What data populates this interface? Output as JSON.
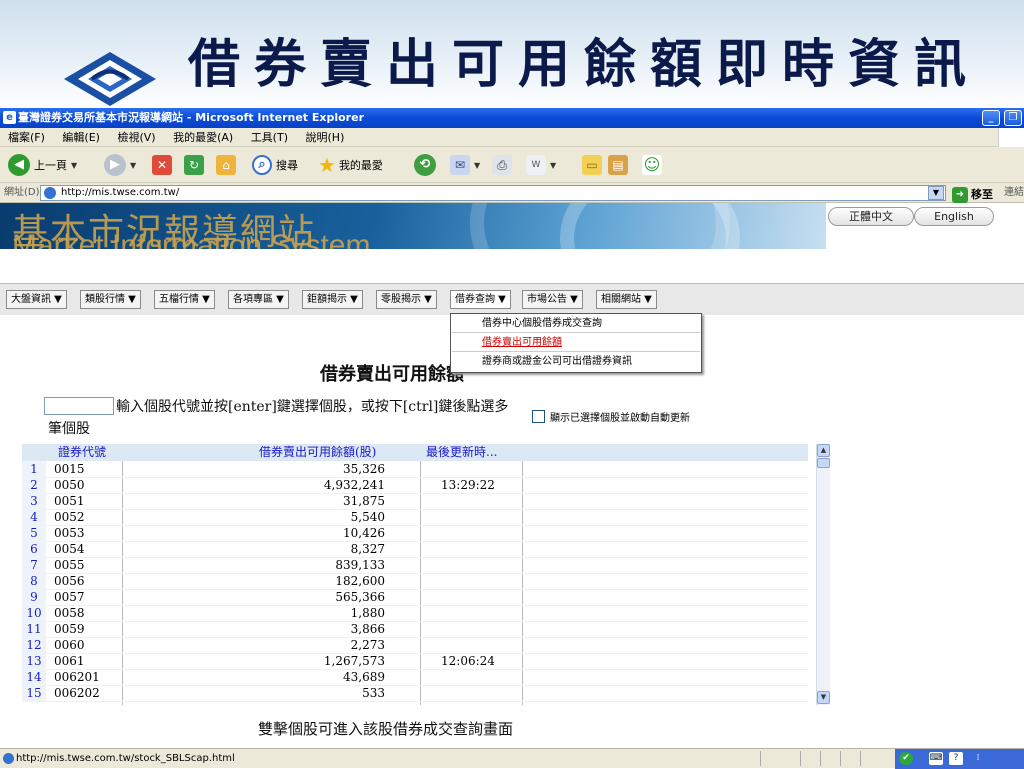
{
  "slide": {
    "title": "借券賣出可用餘額即時資訊"
  },
  "window": {
    "title": "臺灣證券交易所基本市況報導網站 - Microsoft Internet Explorer",
    "minimize": "_",
    "restore": "❐"
  },
  "menubar": {
    "items": [
      "檔案(F)",
      "編輯(E)",
      "檢視(V)",
      "我的最愛(A)",
      "工具(T)",
      "說明(H)"
    ]
  },
  "toolbar": {
    "back_label": "上一頁",
    "search_label": "搜尋",
    "favorites_label": "我的最愛"
  },
  "addressbar": {
    "label": "網址(D)",
    "url": "http://mis.twse.com.tw/",
    "go_label": "移至",
    "links_label": "連結"
  },
  "banner": {
    "title_zh": "基本市況報導網站",
    "title_en": "Market Information System",
    "lang_zh": "正體中文",
    "lang_en": "English"
  },
  "nav": {
    "items": [
      "大盤資訊 ▼",
      "類股行情 ▼",
      "五檔行情 ▼",
      "各項專區 ▼",
      "鉅額揭示 ▼",
      "零股揭示 ▼",
      "借券查詢 ▼",
      "市場公告 ▼",
      "相關網站 ▼"
    ],
    "dropdown": [
      "借券中心個股借券成交查詢",
      "借券賣出可用餘額",
      "證券商或證金公司可出借證券資訊"
    ]
  },
  "content": {
    "title": "借券賣出可用餘額",
    "instruction": "輸入個股代號並按[enter]鍵選擇個股，或按下[ctrl]鍵後點選多筆個股",
    "auto_update_label": "顯示已選擇個股並啟動自動更新",
    "stock_input_value": ""
  },
  "grid": {
    "headers": [
      "證券代號",
      "借券賣出可用餘額(股)",
      "最後更新時..."
    ],
    "rows": [
      {
        "n": "1",
        "code": "0015",
        "bal": "35,326",
        "time": ""
      },
      {
        "n": "2",
        "code": "0050",
        "bal": "4,932,241",
        "time": "13:29:22"
      },
      {
        "n": "3",
        "code": "0051",
        "bal": "31,875",
        "time": ""
      },
      {
        "n": "4",
        "code": "0052",
        "bal": "5,540",
        "time": ""
      },
      {
        "n": "5",
        "code": "0053",
        "bal": "10,426",
        "time": ""
      },
      {
        "n": "6",
        "code": "0054",
        "bal": "8,327",
        "time": ""
      },
      {
        "n": "7",
        "code": "0055",
        "bal": "839,133",
        "time": ""
      },
      {
        "n": "8",
        "code": "0056",
        "bal": "182,600",
        "time": ""
      },
      {
        "n": "9",
        "code": "0057",
        "bal": "565,366",
        "time": ""
      },
      {
        "n": "10",
        "code": "0058",
        "bal": "1,880",
        "time": ""
      },
      {
        "n": "11",
        "code": "0059",
        "bal": "3,866",
        "time": ""
      },
      {
        "n": "12",
        "code": "0060",
        "bal": "2,273",
        "time": ""
      },
      {
        "n": "13",
        "code": "0061",
        "bal": "1,267,573",
        "time": "12:06:24"
      },
      {
        "n": "14",
        "code": "006201",
        "bal": "43,689",
        "time": ""
      },
      {
        "n": "15",
        "code": "006202",
        "bal": "533",
        "time": ""
      }
    ]
  },
  "footer": {
    "note": "雙擊個股可進入該股借券成交查詢畫面"
  },
  "statusbar": {
    "url": "http://mis.twse.com.tw/stock_SBLScap.html"
  }
}
